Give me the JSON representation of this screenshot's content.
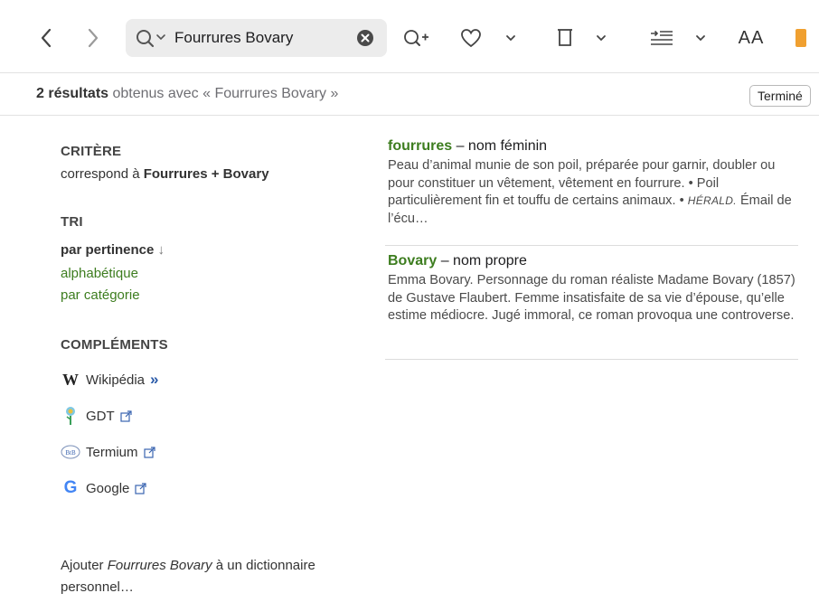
{
  "toolbar": {
    "back_icon": "chevron-left-icon",
    "forward_icon": "chevron-right-icon",
    "search_value": "Fourrures Bovary",
    "buttons": [
      "zoom-in-icon",
      "heart-icon",
      "trash-icon",
      "insert-icon",
      "font-size-icon",
      "bookmark-icon"
    ],
    "font_size_label": "AA"
  },
  "results": {
    "count_label": "2 résultats",
    "query_text": " obtenus avec « Fourrures Bovary »",
    "done_label": "Terminé"
  },
  "sidebar": {
    "criteria_title": "CRITÈRE",
    "criteria_prefix": "correspond à ",
    "criteria_terms": "Fourrures + Bovary",
    "sort_title": "TRI",
    "sort_active": "par pertinence",
    "sort_arrow": "↓",
    "sort_options": [
      "alphabétique",
      "par catégorie"
    ],
    "complements_title": "COMPLÉMENTS",
    "complements": [
      {
        "label": "Wikipédia",
        "icon": "wikipedia-icon"
      },
      {
        "label": "GDT",
        "icon": "gdt-icon"
      },
      {
        "label": "Termium",
        "icon": "termium-icon"
      },
      {
        "label": "Google",
        "icon": "google-icon"
      }
    ],
    "add_prefix": "Ajouter ",
    "add_term": "Fourrures Bovary",
    "add_suffix": " à un dictionnaire personnel…"
  },
  "entries": [
    {
      "headword": "fourrures",
      "category": " – nom féminin",
      "definition_a": "Peau d’animal munie de son poil, préparée pour garnir, doubler ou pour constituer un vêtement, vêtement en fourrure. • Poil particulièrement fin et touffu de certains animaux. • ",
      "definition_source": "HÉRALD.",
      "definition_b": " Émail de l’écu…"
    },
    {
      "headword": "Bovary",
      "category": " – nom propre",
      "definition": "Emma Bovary. Personnage du roman réaliste Madame Bovary (1857) de Gustave Flaubert. Femme insatisfaite de sa vie d’épouse, qu’elle estime médiocre. Jugé immoral, ce roman provoqua une controverse."
    }
  ],
  "colors": {
    "accent_green": "#3d7d1f",
    "bookmark_orange": "#f0a030",
    "link_blue": "#2a5aa8"
  }
}
